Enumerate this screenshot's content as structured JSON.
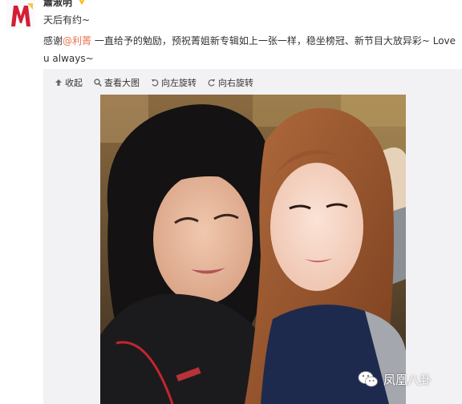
{
  "post": {
    "username": "蕭淑明",
    "line1": "天后有约~",
    "line2_before": "感谢",
    "mention": "@利菁",
    "line2_after": " 一直给予的勉励，预祝菁姐新专辑如上一张一样，稳坐榜冠、新节目大放异彩~ Love u always~"
  },
  "toolbar": {
    "collapse": "收起",
    "view_large": "查看大图",
    "rotate_left": "向左旋转",
    "rotate_right": "向右旋转"
  },
  "watermark": {
    "text": "凤凰八卦"
  },
  "icons": [
    "avatar-logo",
    "vip-badge-icon",
    "collapse-icon",
    "magnifier-icon",
    "rotate-left-icon",
    "rotate-right-icon",
    "wechat-icon"
  ],
  "colors": {
    "mention": "#eb7350",
    "panel_bg": "#f2f2f5",
    "vip_badge": "#f5b800"
  }
}
